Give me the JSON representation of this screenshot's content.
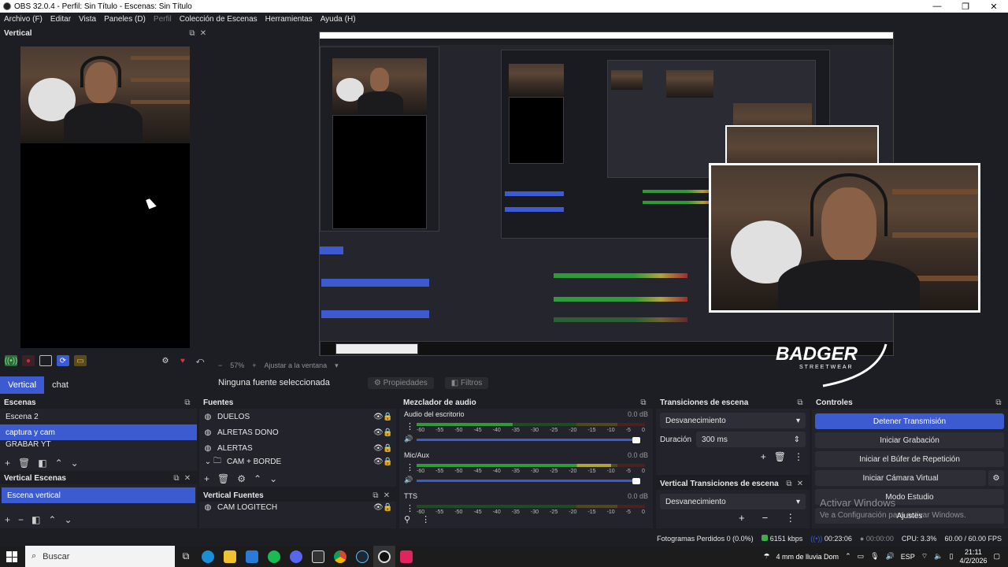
{
  "window": {
    "title": "OBS 32.0.4 - Perfil: Sin Título - Escenas: Sin Título",
    "minimize": "—",
    "maximize": "❐",
    "close": "✕"
  },
  "menu": [
    "Archivo (F)",
    "Editar",
    "Vista",
    "Paneles (D)",
    "Perfil",
    "Colección de Escenas",
    "Herramientas",
    "Ayuda (H)"
  ],
  "vertical_dock": {
    "title": "Vertical"
  },
  "preview": {
    "zoom": "57%",
    "fit": "Ajustar a la ventana",
    "minus": "−",
    "plus": "+",
    "badger_top": "BADGER",
    "badger_bottom": "STREETWEAR"
  },
  "canvas_tabs": [
    "Vertical",
    "chat"
  ],
  "source_bar": {
    "no_source": "Ninguna fuente seleccionada",
    "properties": "Propiedades",
    "filters": "Filtros"
  },
  "scenes": {
    "title": "Escenas",
    "items": [
      "Escena 2",
      "captura y cam",
      "GRABAR YT"
    ],
    "selected": 1
  },
  "vertical_scenes": {
    "title": "Vertical Escenas",
    "items": [
      "Escena vertical"
    ]
  },
  "sources": {
    "title": "Fuentes",
    "items": [
      "DUELOS",
      "ALRETAS DONO",
      "ALERTAS",
      "CAM + BORDE"
    ]
  },
  "vertical_sources": {
    "title": "Vertical Fuentes",
    "items": [
      "CAM LOGITECH"
    ]
  },
  "mixer": {
    "title": "Mezclador de audio",
    "channels": [
      {
        "name": "Audio del escritorio",
        "db": "0.0 dB",
        "level": 0.42
      },
      {
        "name": "Mic/Aux",
        "db": "0.0 dB",
        "level": 0.85
      },
      {
        "name": "TTS",
        "db": "0.0 dB",
        "level": 0.0
      }
    ],
    "scale": [
      "-60",
      "-55",
      "-50",
      "-45",
      "-40",
      "-35",
      "-30",
      "-25",
      "-20",
      "-15",
      "-10",
      "-5",
      "0"
    ]
  },
  "transitions": {
    "title": "Transiciones de escena",
    "type": "Desvanecimiento",
    "duration_label": "Duración",
    "duration_value": "300 ms"
  },
  "vertical_transitions": {
    "title": "Vertical Transiciones de escena",
    "type": "Desvanecimiento"
  },
  "controls": {
    "title": "Controles",
    "stop_stream": "Detener Transmisión",
    "start_recording": "Iniciar Grabación",
    "replay_buffer": "Iniciar el Búfer de Repetición",
    "virtual_cam": "Iniciar Cámara Virtual",
    "studio_mode": "Modo Estudio",
    "settings": "Ajustes"
  },
  "activate_windows": {
    "title": "Activar Windows",
    "subtitle": "Ve a Configuración para activar Windows."
  },
  "status": {
    "dropped": "Fotogramas Perdidos 0 (0.0%)",
    "bitrate": "6151 kbps",
    "stream_time": "00:23:06",
    "rec_time": "00:00:00",
    "cpu": "CPU: 3.3%",
    "fps": "60.00 / 60.00 FPS"
  },
  "taskbar": {
    "search": "Buscar",
    "weather": "4 mm de lluvia Dom",
    "lang": "ESP",
    "time": "21:11",
    "date": "4/2/2026"
  },
  "colors": {
    "accent": "#3c5bd1",
    "bg": "#1d1e24",
    "panel": "#23242b",
    "meter_green": "#2e9a3a",
    "meter_yellow": "#b3a33b",
    "meter_red": "#9a2f2f"
  }
}
